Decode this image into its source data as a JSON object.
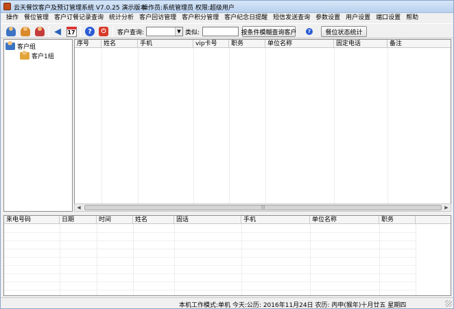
{
  "window": {
    "title": "云天餐饮客户及预订管理系统 V7.0.25 演示版本",
    "operator_info": "操作员:系统管理员  权限:超级用户"
  },
  "menu": [
    "操作",
    "餐位管理",
    "客户订餐记录查询",
    "统计分析",
    "客户回访管理",
    "客户积分管理",
    "客户纪念日提醒",
    "短信发送查询",
    "参数设置",
    "用户设置",
    "端口设置",
    "帮助"
  ],
  "toolbar": {
    "icons": [
      "customer-icon",
      "customer-add-icon",
      "customer-delete-icon",
      "speaker-icon",
      "calendar-icon",
      "help-icon",
      "power-icon"
    ],
    "calendar_day": "17",
    "help_glyph": "?",
    "customer_query_label": "客户查询:",
    "customer_query_value": "",
    "similar_label": "类似:",
    "similar_value": "",
    "fuzzy_query_button": "按条件模糊查询客户",
    "seat_status_button": "餐位状态统计"
  },
  "tree": {
    "root": "客户组",
    "children": [
      "客户1组"
    ]
  },
  "customer_table": {
    "columns": [
      "序号",
      "姓名",
      "手机",
      "vip卡号",
      "职务",
      "单位名称",
      "固定电话",
      "备注"
    ],
    "rows": []
  },
  "scroll_thumb_glyph": "|||",
  "call_table": {
    "columns": [
      "来电号码",
      "日期",
      "时间",
      "姓名",
      "固话",
      "手机",
      "单位名称",
      "职务"
    ],
    "rows": []
  },
  "statusbar": {
    "text": "本机工作模式:单机    今天:公历: 2016年11月24日    农历: 丙申(猴年)十月廿五      星期四"
  }
}
